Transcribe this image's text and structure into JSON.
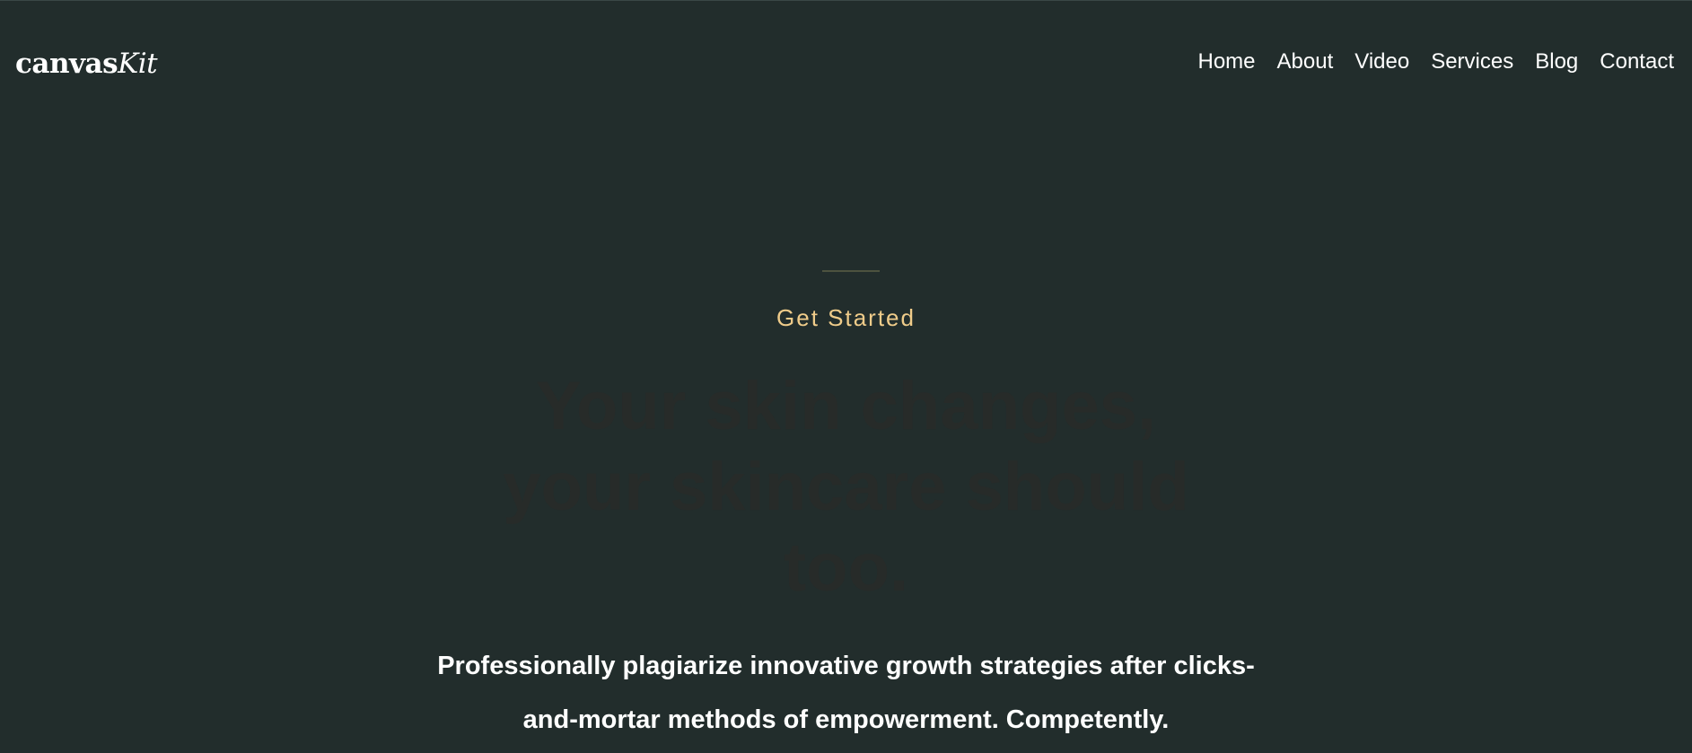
{
  "header": {
    "logo": {
      "bold": "canvas",
      "italic": "Kit"
    },
    "nav": [
      {
        "label": "Home"
      },
      {
        "label": "About"
      },
      {
        "label": "Video"
      },
      {
        "label": "Services"
      },
      {
        "label": "Blog"
      },
      {
        "label": "Contact"
      }
    ]
  },
  "hero": {
    "kicker": "Get Started",
    "title_lines": [
      "Your skin changes,",
      "your skincare should",
      "too."
    ],
    "subtitle_lines": [
      "Professionally plagiarize innovative growth strategies after clicks-",
      "and-mortar methods of empowerment. Competently."
    ]
  },
  "colors": {
    "background": "#222d2c",
    "accent": "#f0cc8a",
    "title": "#272b29",
    "text": "#ffffff"
  }
}
